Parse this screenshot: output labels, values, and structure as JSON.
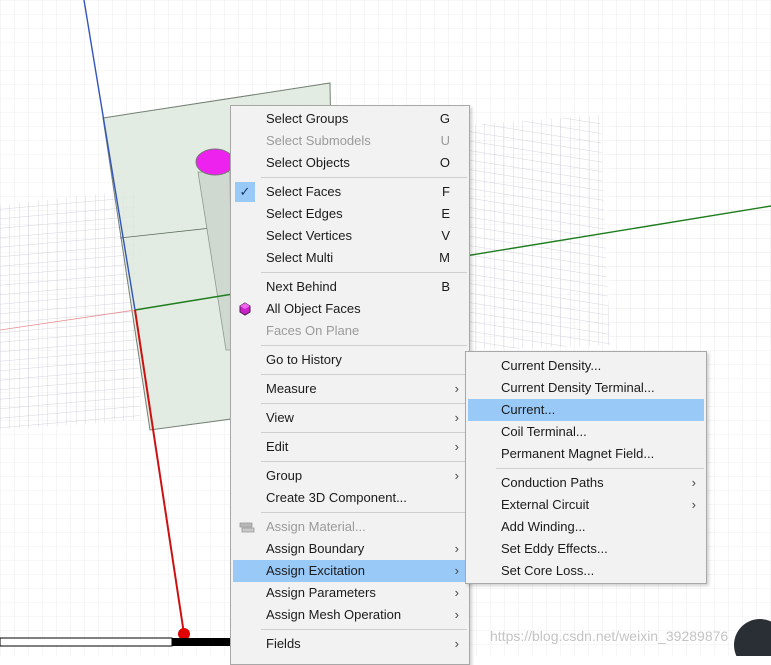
{
  "context_menu": {
    "items": [
      {
        "label": "Select Groups",
        "shortcut": "G"
      },
      {
        "label": "Select Submodels",
        "shortcut": "U"
      },
      {
        "label": "Select Objects",
        "shortcut": "O"
      },
      {
        "label": "Select Faces",
        "shortcut": "F"
      },
      {
        "label": "Select Edges",
        "shortcut": "E"
      },
      {
        "label": "Select Vertices",
        "shortcut": "V"
      },
      {
        "label": "Select Multi",
        "shortcut": "M"
      },
      {
        "label": "Next Behind",
        "shortcut": "B"
      },
      {
        "label": "All Object Faces"
      },
      {
        "label": "Faces On Plane"
      },
      {
        "label": "Go to History"
      },
      {
        "label": "Measure"
      },
      {
        "label": "View"
      },
      {
        "label": "Edit"
      },
      {
        "label": "Group"
      },
      {
        "label": "Create 3D Component..."
      },
      {
        "label": "Assign Material..."
      },
      {
        "label": "Assign Boundary"
      },
      {
        "label": "Assign Excitation"
      },
      {
        "label": "Assign Parameters"
      },
      {
        "label": "Assign Mesh Operation"
      },
      {
        "label": "Fields"
      }
    ]
  },
  "submenu": {
    "items": [
      {
        "label": "Current Density..."
      },
      {
        "label": "Current Density Terminal..."
      },
      {
        "label": "Current..."
      },
      {
        "label": "Coil Terminal..."
      },
      {
        "label": "Permanent Magnet Field..."
      },
      {
        "label": "Conduction Paths"
      },
      {
        "label": "External Circuit"
      },
      {
        "label": "Add Winding..."
      },
      {
        "label": "Set Eddy Effects..."
      },
      {
        "label": "Set Core Loss..."
      }
    ]
  },
  "watermark": "https://blog.csdn.net/weixin_39289876",
  "colors": {
    "highlight": "#99c9f7",
    "x_axis": "#1e7d1e",
    "y_axis": "#3355bb",
    "z_axis": "#cc1111",
    "object_face": "#ee22ee"
  },
  "icons": {
    "check": "✓",
    "submenu_arrow": "›"
  }
}
